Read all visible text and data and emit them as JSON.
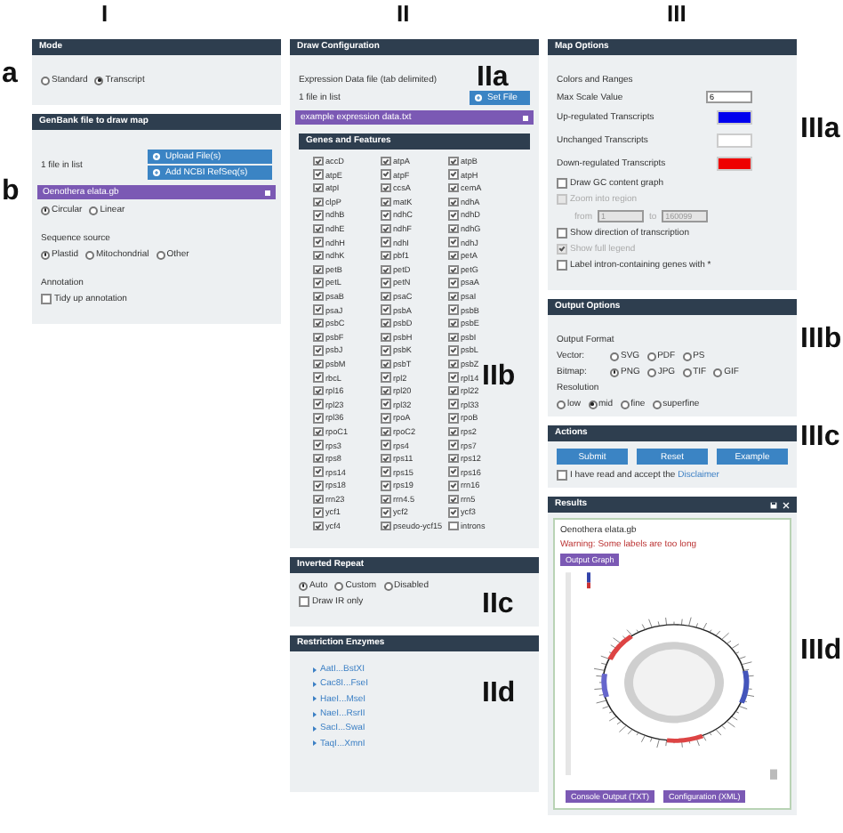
{
  "figure_labels": [
    {
      "text": "I"
    },
    {
      "text": "II"
    },
    {
      "text": "III"
    },
    {
      "text": "a"
    },
    {
      "text": "b"
    },
    {
      "text": "IIa"
    },
    {
      "text": "IIb"
    },
    {
      "text": "IIc"
    },
    {
      "text": "IId"
    },
    {
      "text": "IIIa"
    },
    {
      "text": "IIIb"
    },
    {
      "text": "IIIc"
    },
    {
      "text": "IIId"
    }
  ],
  "mode_panel": {
    "title": "Mode",
    "options": [
      {
        "label": "Standard",
        "selected": false
      },
      {
        "label": "Transcript",
        "selected": true
      }
    ]
  },
  "genbank_panel": {
    "title": "GenBank file to draw map",
    "file_count": "1 file in list",
    "buttons": [
      "Upload File(s)",
      "Add NCBI RefSeq(s)"
    ],
    "file": "Oenothera elata.gb",
    "topology": [
      {
        "label": "Circular",
        "selected": true
      },
      {
        "label": "Linear",
        "selected": false
      }
    ],
    "sequence_source": {
      "label": "Sequence source",
      "options": [
        {
          "label": "Plastid",
          "selected": true
        },
        {
          "label": "Mitochondrial",
          "selected": false
        },
        {
          "label": "Other",
          "selected": false
        }
      ]
    },
    "annotation": {
      "label": "Annotation",
      "checkbox": {
        "label": "Tidy up annotation",
        "checked": false
      }
    }
  },
  "draw_configuration": {
    "title": "Draw Configuration",
    "expression_label": "Expression Data file (tab delimited)",
    "file_count": "1 file in list",
    "set_button": "Set File",
    "file": "example expression data.txt",
    "genes": {
      "title": "Genes and Features",
      "items": [
        {
          "label": "accD",
          "checked": true
        },
        {
          "label": "atpA",
          "checked": true
        },
        {
          "label": "atpB",
          "checked": true
        },
        {
          "label": "atpE",
          "checked": true
        },
        {
          "label": "atpF",
          "checked": true
        },
        {
          "label": "atpH",
          "checked": true
        },
        {
          "label": "atpI",
          "checked": true
        },
        {
          "label": "ccsA",
          "checked": true
        },
        {
          "label": "cemA",
          "checked": true
        },
        {
          "label": "clpP",
          "checked": true
        },
        {
          "label": "matK",
          "checked": true
        },
        {
          "label": "ndhA",
          "checked": true
        },
        {
          "label": "ndhB",
          "checked": true
        },
        {
          "label": "ndhC",
          "checked": true
        },
        {
          "label": "ndhD",
          "checked": true
        },
        {
          "label": "ndhE",
          "checked": true
        },
        {
          "label": "ndhF",
          "checked": true
        },
        {
          "label": "ndhG",
          "checked": true
        },
        {
          "label": "ndhH",
          "checked": true
        },
        {
          "label": "ndhI",
          "checked": true
        },
        {
          "label": "ndhJ",
          "checked": true
        },
        {
          "label": "ndhK",
          "checked": true
        },
        {
          "label": "pbf1",
          "checked": true
        },
        {
          "label": "petA",
          "checked": true
        },
        {
          "label": "petB",
          "checked": true
        },
        {
          "label": "petD",
          "checked": true
        },
        {
          "label": "petG",
          "checked": true
        },
        {
          "label": "petL",
          "checked": true
        },
        {
          "label": "petN",
          "checked": true
        },
        {
          "label": "psaA",
          "checked": true
        },
        {
          "label": "psaB",
          "checked": true
        },
        {
          "label": "psaC",
          "checked": true
        },
        {
          "label": "psaI",
          "checked": true
        },
        {
          "label": "psaJ",
          "checked": true
        },
        {
          "label": "psbA",
          "checked": true
        },
        {
          "label": "psbB",
          "checked": true
        },
        {
          "label": "psbC",
          "checked": true
        },
        {
          "label": "psbD",
          "checked": true
        },
        {
          "label": "psbE",
          "checked": true
        },
        {
          "label": "psbF",
          "checked": true
        },
        {
          "label": "psbH",
          "checked": true
        },
        {
          "label": "psbI",
          "checked": true
        },
        {
          "label": "psbJ",
          "checked": true
        },
        {
          "label": "psbK",
          "checked": true
        },
        {
          "label": "psbL",
          "checked": true
        },
        {
          "label": "psbM",
          "checked": true
        },
        {
          "label": "psbT",
          "checked": true
        },
        {
          "label": "psbZ",
          "checked": true
        },
        {
          "label": "rbcL",
          "checked": true
        },
        {
          "label": "rpl2",
          "checked": true
        },
        {
          "label": "rpl14",
          "checked": true
        },
        {
          "label": "rpl16",
          "checked": true
        },
        {
          "label": "rpl20",
          "checked": true
        },
        {
          "label": "rpl22",
          "checked": true
        },
        {
          "label": "rpl23",
          "checked": true
        },
        {
          "label": "rpl32",
          "checked": true
        },
        {
          "label": "rpl33",
          "checked": true
        },
        {
          "label": "rpl36",
          "checked": true
        },
        {
          "label": "rpoA",
          "checked": true
        },
        {
          "label": "rpoB",
          "checked": true
        },
        {
          "label": "rpoC1",
          "checked": true
        },
        {
          "label": "rpoC2",
          "checked": true
        },
        {
          "label": "rps2",
          "checked": true
        },
        {
          "label": "rps3",
          "checked": true
        },
        {
          "label": "rps4",
          "checked": true
        },
        {
          "label": "rps7",
          "checked": true
        },
        {
          "label": "rps8",
          "checked": true
        },
        {
          "label": "rps11",
          "checked": true
        },
        {
          "label": "rps12",
          "checked": true
        },
        {
          "label": "rps14",
          "checked": true
        },
        {
          "label": "rps15",
          "checked": true
        },
        {
          "label": "rps16",
          "checked": true
        },
        {
          "label": "rps18",
          "checked": true
        },
        {
          "label": "rps19",
          "checked": true
        },
        {
          "label": "rrn16",
          "checked": true
        },
        {
          "label": "rrn23",
          "checked": true
        },
        {
          "label": "rrn4.5",
          "checked": true
        },
        {
          "label": "rrn5",
          "checked": true
        },
        {
          "label": "ycf1",
          "checked": true
        },
        {
          "label": "ycf2",
          "checked": true
        },
        {
          "label": "ycf3",
          "checked": true
        },
        {
          "label": "ycf4",
          "checked": true
        },
        {
          "label": "pseudo-ycf15",
          "checked": true
        },
        {
          "label": "introns",
          "checked": false
        }
      ]
    }
  },
  "inverted_repeat": {
    "title": "Inverted Repeat",
    "options": [
      {
        "label": "Auto",
        "selected": true
      },
      {
        "label": "Custom",
        "selected": false
      },
      {
        "label": "Disabled",
        "selected": false
      }
    ],
    "draw_ir_only": {
      "label": "Draw IR only",
      "checked": false
    }
  },
  "restriction_enzymes": {
    "title": "Restriction Enzymes",
    "items": [
      "AatI...BstXI",
      "Cac8I...FseI",
      "HaeI...MseI",
      "NaeI...RsrII",
      "SacI...SwaI",
      "TaqI...XmnI"
    ]
  },
  "map_options": {
    "title": "Map Options",
    "section": "Colors and Ranges",
    "max_scale": {
      "label": "Max Scale Value",
      "value": "6"
    },
    "colors": [
      {
        "label": "Up-regulated Transcripts",
        "color": "#0000ee"
      },
      {
        "label": "Unchanged Transcripts",
        "color": "#ffffff"
      },
      {
        "label": "Down-regulated Transcripts",
        "color": "#ee0000"
      }
    ],
    "checkboxes": [
      {
        "kind": "check",
        "label": "Draw GC content graph",
        "checked": false,
        "disabled": false
      },
      {
        "kind": "range",
        "label": "Zoom into region",
        "checked": false,
        "disabled": true,
        "from_label": "from",
        "from": "1",
        "to_label": "to",
        "to": "160099"
      },
      {
        "kind": "check",
        "label": "Show direction of transcription",
        "checked": false,
        "disabled": false
      },
      {
        "kind": "check",
        "label": "Show full legend",
        "checked": true,
        "disabled": true
      },
      {
        "kind": "check",
        "label": "Label intron-containing genes with *",
        "checked": false,
        "disabled": false
      }
    ]
  },
  "output_options": {
    "title": "Output Options",
    "format_label": "Output Format",
    "rows": [
      {
        "label": "Vector:",
        "options": [
          {
            "label": "SVG",
            "selected": false
          },
          {
            "label": "PDF",
            "selected": false
          },
          {
            "label": "PS",
            "selected": false
          }
        ]
      },
      {
        "label": "Bitmap:",
        "options": [
          {
            "label": "PNG",
            "selected": true
          },
          {
            "label": "JPG",
            "selected": false
          },
          {
            "label": "TIF",
            "selected": false
          },
          {
            "label": "GIF",
            "selected": false
          }
        ]
      }
    ],
    "resolution": {
      "label": "Resolution",
      "options": [
        {
          "label": "low",
          "selected": false
        },
        {
          "label": "mid",
          "selected": true
        },
        {
          "label": "fine",
          "selected": false
        },
        {
          "label": "superfine",
          "selected": false
        }
      ]
    }
  },
  "actions": {
    "title": "Actions",
    "buttons": [
      "Submit",
      "Reset",
      "Example"
    ],
    "disclaimer": {
      "checked": false,
      "text": "I have read and accept the",
      "link": "Disclaimer"
    }
  },
  "results": {
    "title": "Results",
    "file": "Oenothera elata.gb",
    "warning": "Warning: Some labels are too long",
    "graph_button": "Output Graph",
    "buttons": [
      "Console Output (TXT)",
      "Configuration (XML)"
    ]
  }
}
